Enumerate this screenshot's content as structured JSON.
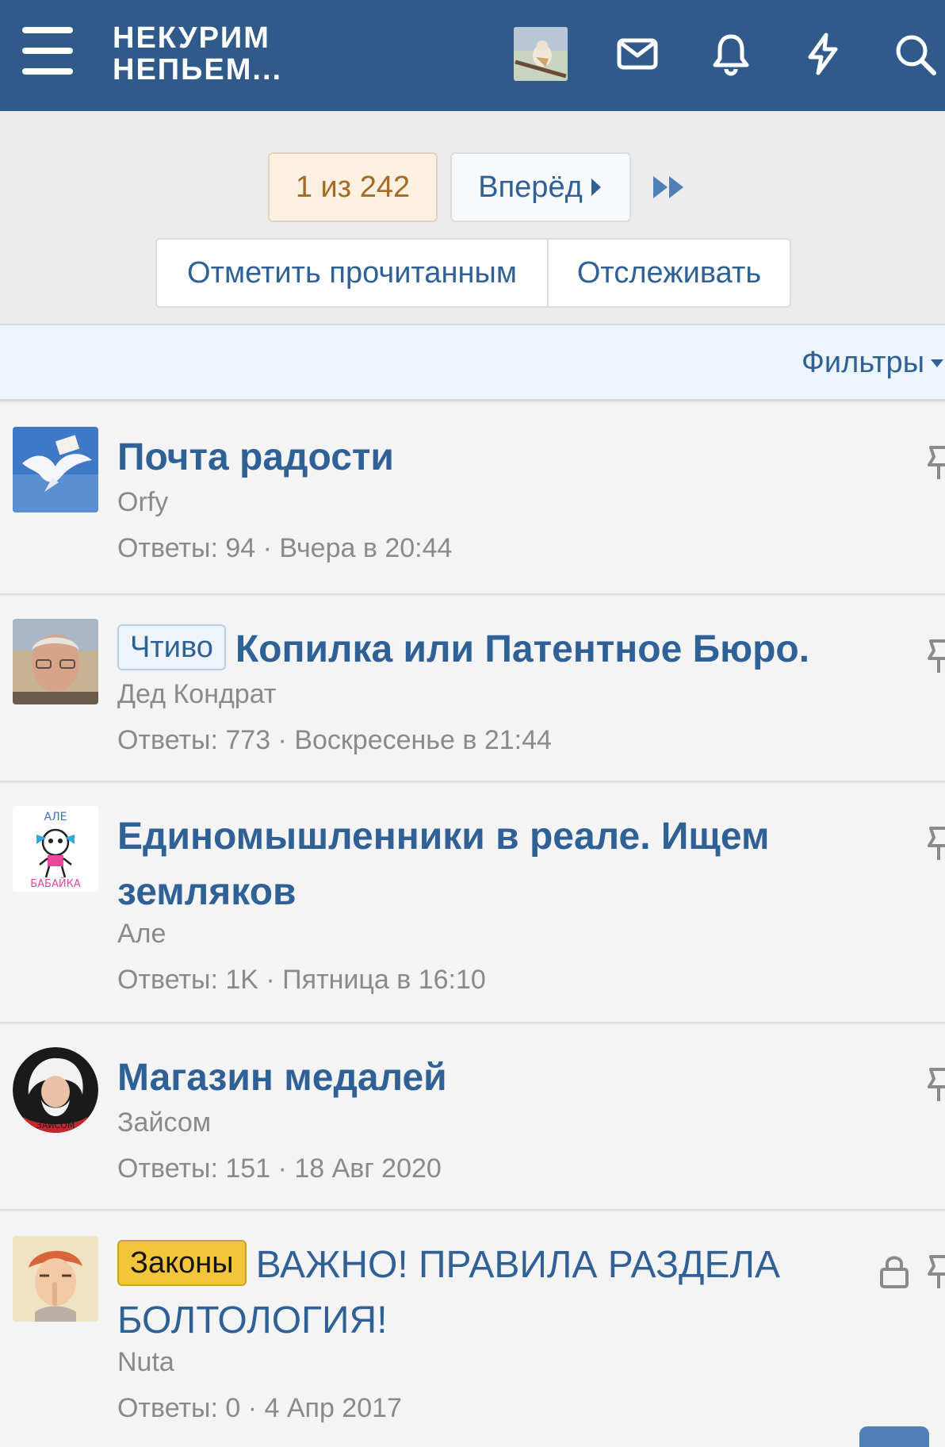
{
  "header": {
    "logo_line1": "НЕКУРИМ",
    "logo_line2": "НЕПЬЕМ..."
  },
  "pagination": {
    "current": "1 из 242",
    "next": "Вперёд"
  },
  "actions": {
    "mark_read": "Отметить прочитанным",
    "watch": "Отслеживать"
  },
  "filters": {
    "label": "Фильтры"
  },
  "threads": [
    {
      "prefix": "",
      "title": "Почта радости",
      "author": "Orfy",
      "meta": "Ответы: 94 · Вчера в 20:44"
    },
    {
      "prefix": "Чтиво",
      "title": "Копилка или Патентное Бюро.",
      "author": "Дед Кондрат",
      "meta": "Ответы: 773 · Воскресенье в 21:44"
    },
    {
      "prefix": "",
      "title": "Единомышленники в реале. Ищем земляков",
      "author": "Але",
      "meta": "Ответы: 1K · Пятница в 16:10",
      "avatar_text_top": "АЛЕ",
      "avatar_text_bottom": "БАБАЙКА"
    },
    {
      "prefix": "",
      "title": "Магазин медалей",
      "author": "Зайсом",
      "meta": "Ответы: 151 · 18 Авг 2020",
      "avatar_text": "ЗАЙСОМ"
    },
    {
      "prefix": "Законы",
      "title": "ВАЖНО! ПРАВИЛА РАЗДЕЛА БОЛТОЛОГИЯ!",
      "author": "Nuta",
      "meta": "Ответы: 0 · 4 Апр 2017"
    }
  ],
  "colors": {
    "header_bg": "#2f5a89",
    "link": "#2f6196",
    "muted": "#8a8a8a",
    "prefix_yellow": "#f3c53a"
  }
}
